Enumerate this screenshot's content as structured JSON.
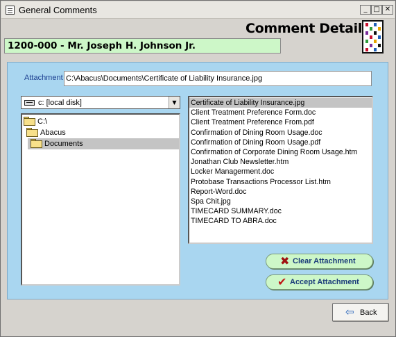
{
  "window": {
    "title": "General Comments",
    "minimize_label": "_",
    "maximize_label": "□",
    "close_label": "✕"
  },
  "header": {
    "page_title": "Comment Detail",
    "client": "1200-000 - Mr. Joseph H. Johnson Jr.",
    "logo_icon": "abacus-logo-icon"
  },
  "attachment": {
    "label": "Attachment",
    "value": "C:\\Abacus\\Documents\\Certificate of Liability Insurance.jpg"
  },
  "drive": {
    "icon": "disk-drive-icon",
    "selected": "c: [local disk]",
    "arrow": "▼"
  },
  "directories": [
    {
      "label": "C:\\",
      "depth": 0,
      "selected": false
    },
    {
      "label": "Abacus",
      "depth": 1,
      "selected": false
    },
    {
      "label": "Documents",
      "depth": 2,
      "selected": true
    }
  ],
  "files": [
    {
      "label": "Certificate of Liability Insurance.jpg",
      "selected": true
    },
    {
      "label": "Client Treatment Preference Form.doc",
      "selected": false
    },
    {
      "label": "Client Treatment Preference From.pdf",
      "selected": false
    },
    {
      "label": "Confirmation of Dining Room Usage.doc",
      "selected": false
    },
    {
      "label": "Confirmation of Dining Room Usage.pdf",
      "selected": false
    },
    {
      "label": "Confirmation of Corporate Dining Room Usage.htm",
      "selected": false
    },
    {
      "label": "Jonathan Club Newsletter.htm",
      "selected": false
    },
    {
      "label": "Locker Managerment.doc",
      "selected": false
    },
    {
      "label": "Protobase Transactions Processor List.htm",
      "selected": false
    },
    {
      "label": "Report-Word.doc",
      "selected": false
    },
    {
      "label": "Spa Chit.jpg",
      "selected": false
    },
    {
      "label": "TIMECARD SUMMARY.doc",
      "selected": false
    },
    {
      "label": "TIMECARD TO ABRA.doc",
      "selected": false
    }
  ],
  "actions": {
    "clear_label": "Clear Attachment",
    "clear_icon": "x-icon",
    "accept_label": "Accept Attachment",
    "accept_icon": "checkmark-icon",
    "back_label": "Back",
    "back_icon": "back-arrow-icon"
  },
  "colors": {
    "panel_bg": "#a9d6f0",
    "client_bg": "#cdf7c8",
    "button_bg": "#cdf7c8",
    "button_text": "#1a3b7a",
    "selection_bg": "#c4c4c4"
  }
}
